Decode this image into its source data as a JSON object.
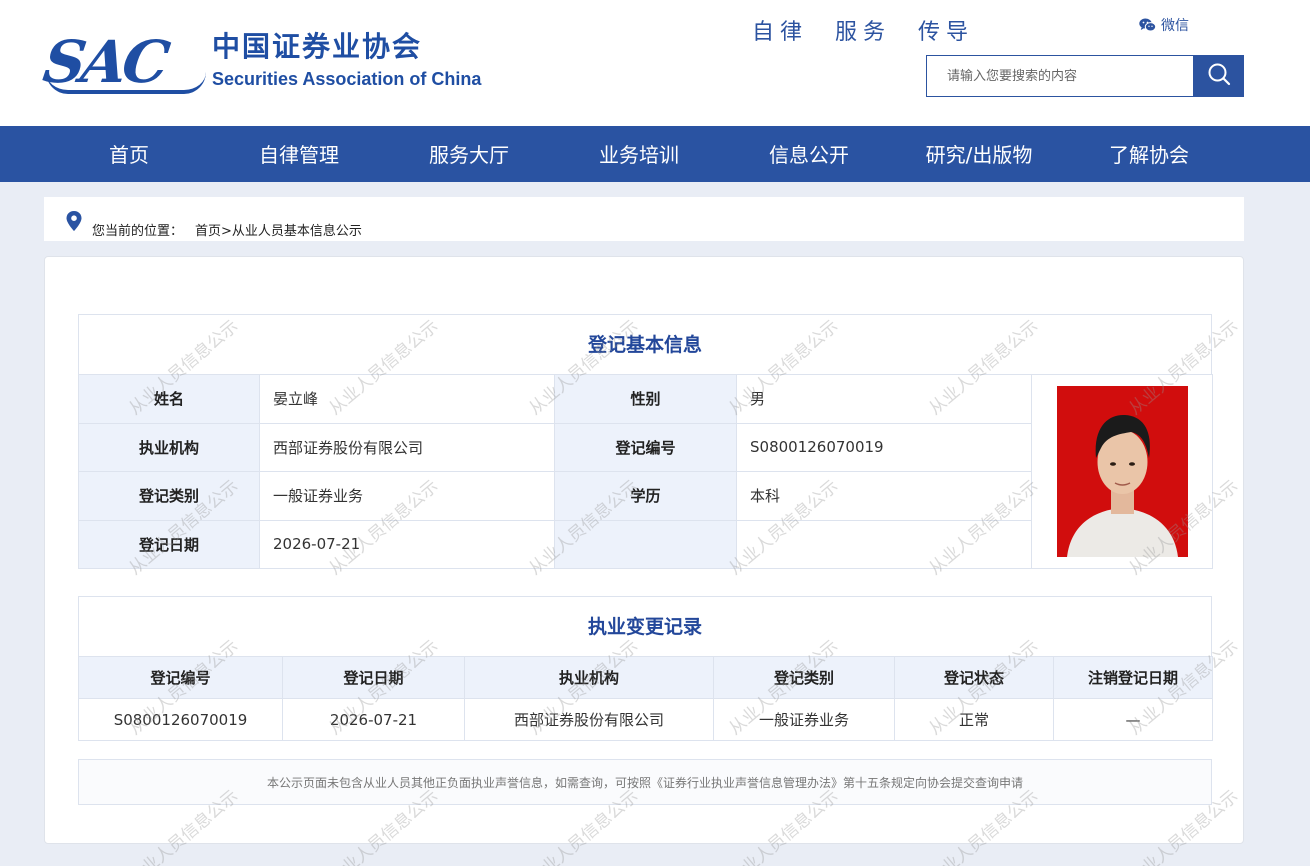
{
  "header": {
    "logo_mark": "SAC",
    "logo_cn": "中国证券业协会",
    "logo_en": "Securities Association of China",
    "slogan": "自律 服务 传导",
    "wechat_label": "微信",
    "search_placeholder": "请输入您要搜索的内容"
  },
  "nav": {
    "items": [
      "首页",
      "自律管理",
      "服务大厅",
      "业务培训",
      "信息公开",
      "研究/出版物",
      "了解协会"
    ]
  },
  "breadcrumb": {
    "label": "您当前的位置：",
    "path": "首页>从业人员基本信息公示"
  },
  "basic_info": {
    "title": "登记基本信息",
    "rows": [
      {
        "label1": "姓名",
        "value1": "晏立峰",
        "label2": "性别",
        "value2": "男"
      },
      {
        "label1": "执业机构",
        "value1": "西部证券股份有限公司",
        "label2": "登记编号",
        "value2": "S0800126070019"
      },
      {
        "label1": "登记类别",
        "value1": "一般证券业务",
        "label2": "学历",
        "value2": "本科"
      },
      {
        "label1": "登记日期",
        "value1": "2026-07-21",
        "label2": "",
        "value2": ""
      }
    ]
  },
  "records": {
    "title": "执业变更记录",
    "columns": [
      "登记编号",
      "登记日期",
      "执业机构",
      "登记类别",
      "登记状态",
      "注销登记日期"
    ],
    "rows": [
      [
        "S0800126070019",
        "2026-07-21",
        "西部证券股份有限公司",
        "一般证券业务",
        "正常",
        "—"
      ]
    ]
  },
  "note": "本公示页面未包含从业人员其他正负面执业声誉信息，如需查询，可按照《证券行业执业声誉信息管理办法》第十五条规定向协会提交查询申请",
  "watermark_text": "从业人员信息公示",
  "colors": {
    "brand_blue": "#2a53a2",
    "title_blue": "#23479a",
    "label_bg": "#edf2fb",
    "photo_bg": "#d10d0d"
  }
}
